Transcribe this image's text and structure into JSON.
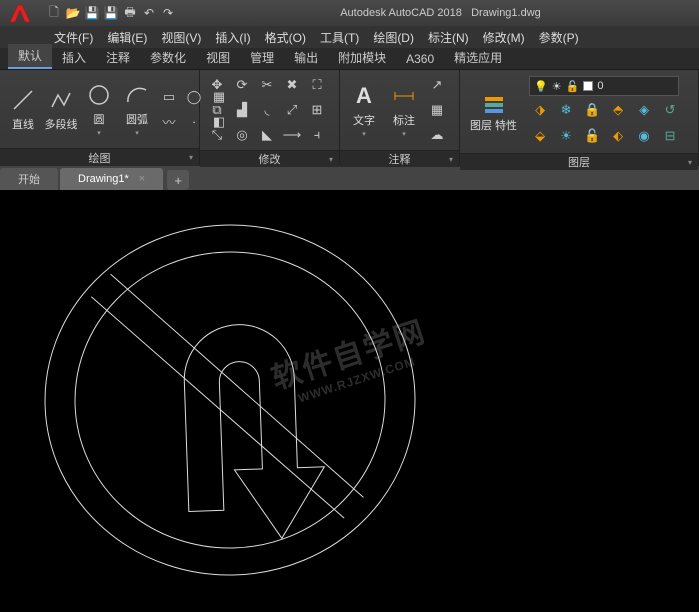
{
  "app": {
    "title": "Autodesk AutoCAD 2018",
    "document": "Drawing1.dwg"
  },
  "menus": [
    {
      "label": "文件(F)"
    },
    {
      "label": "编辑(E)"
    },
    {
      "label": "视图(V)"
    },
    {
      "label": "插入(I)"
    },
    {
      "label": "格式(O)"
    },
    {
      "label": "工具(T)"
    },
    {
      "label": "绘图(D)"
    },
    {
      "label": "标注(N)"
    },
    {
      "label": "修改(M)"
    },
    {
      "label": "参数(P)"
    }
  ],
  "ribbon_tabs": [
    {
      "label": "默认"
    },
    {
      "label": "插入"
    },
    {
      "label": "注释"
    },
    {
      "label": "参数化"
    },
    {
      "label": "视图"
    },
    {
      "label": "管理"
    },
    {
      "label": "输出"
    },
    {
      "label": "附加模块"
    },
    {
      "label": "A360"
    },
    {
      "label": "精选应用"
    }
  ],
  "panels": {
    "draw": {
      "title": "绘图",
      "line": "直线",
      "polyline": "多段线",
      "circle": "圆",
      "arc": "圆弧"
    },
    "modify": {
      "title": "修改"
    },
    "annotate": {
      "title": "注释",
      "text": "文字",
      "dimension": "标注"
    },
    "layer": {
      "title": "图层",
      "props": "图层\n特性",
      "current": "0"
    }
  },
  "doc_tabs": {
    "start": "开始",
    "drawing": "Drawing1*"
  },
  "watermark": {
    "main": "软件自学网",
    "sub": "WWW.RJZXW.COM"
  }
}
